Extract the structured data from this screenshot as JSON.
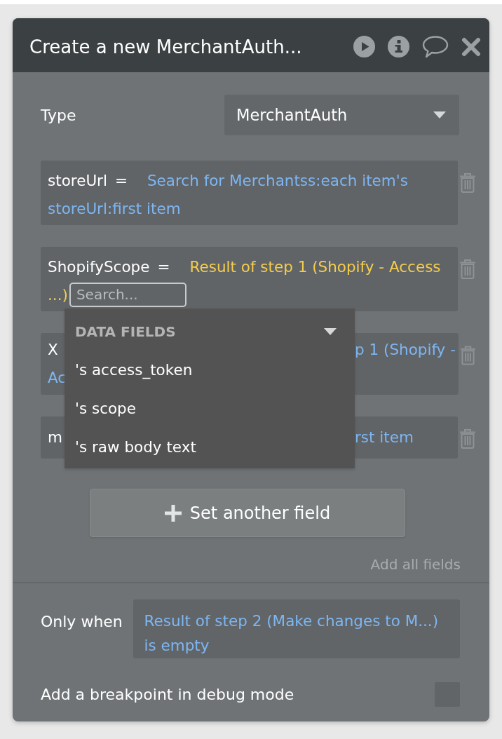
{
  "window": {
    "title": "Create a new MerchantAuth..."
  },
  "type_field": {
    "label": "Type",
    "value": "MerchantAuth"
  },
  "fields": [
    {
      "kind": "full",
      "key": "storeUrl",
      "operator": "=",
      "value_lines": [
        "Search for Merchantss:each item's",
        "storeUrl:first item"
      ],
      "editing": false
    },
    {
      "kind": "full",
      "key": "ShopifyScope",
      "operator": "=",
      "value_lines": [
        "Result of step 1 (Shopify - Access",
        "...)"
      ],
      "editing": true,
      "search": {
        "placeholder": "Search..."
      }
    },
    {
      "kind": "covered",
      "key": "X",
      "value_parts": [
        "p 1 (Shopify -",
        "Ac"
      ],
      "editing": false
    },
    {
      "kind": "covered",
      "key": "m",
      "value_parts": [
        "rst item"
      ],
      "editing": false
    }
  ],
  "dropdown": {
    "header": "DATA FIELDS",
    "items": [
      {
        "label": "'s access_token",
        "selected": false
      },
      {
        "label": "'s scope",
        "selected": false
      },
      {
        "label": "'s raw body text",
        "selected": false
      }
    ]
  },
  "add_button": {
    "label": "Set another field"
  },
  "add_all_link": "Add all fields",
  "condition": {
    "label": "Only when",
    "value": "Result of step 2 (Make changes to M...) is empty"
  },
  "breakpoint": {
    "label": "Add a breakpoint in debug mode",
    "checked": false
  }
}
